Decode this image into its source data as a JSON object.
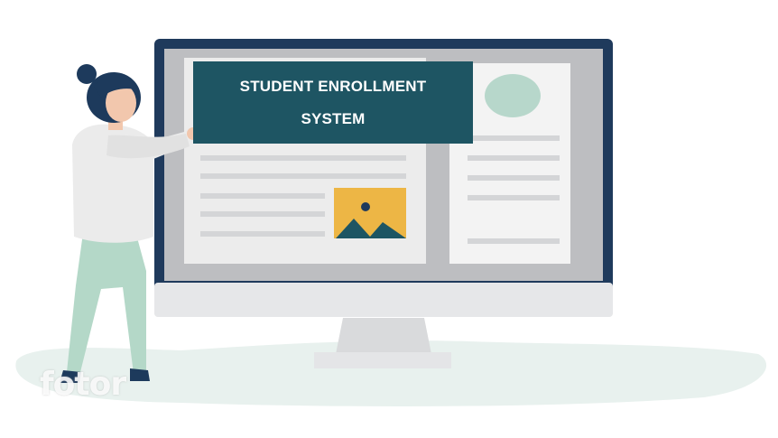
{
  "banner": {
    "line1": "STUDENT ENROLLMENT",
    "line2": "SYSTEM"
  },
  "watermark": "fotor",
  "colors": {
    "banner": "#1e5563",
    "monitor_bezel": "#1f3a5c",
    "floor": "#e8f1ee",
    "pants": "#b4d8c8",
    "hair": "#1d3a5c",
    "image_card": "#edb645"
  },
  "icons": [
    "image-placeholder-icon",
    "avatar-circle-icon"
  ]
}
